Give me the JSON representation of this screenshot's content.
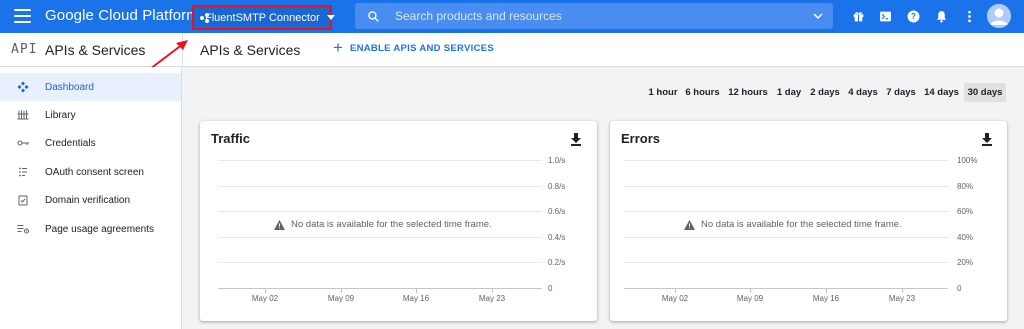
{
  "topbar": {
    "brand": "Google Cloud Platform",
    "project_name": "FluentSMTP Connector",
    "search_placeholder": "Search products and resources",
    "icons": [
      "gift-icon",
      "terminal-icon",
      "help-icon",
      "notifications-icon",
      "more-vert-icon"
    ]
  },
  "subheader": {
    "logo": "API",
    "section_title": "APIs & Services",
    "page_title": "APIs & Services",
    "enable_label": "ENABLE APIS AND SERVICES"
  },
  "sidebar": {
    "items": [
      {
        "label": "Dashboard",
        "icon": "dashboard-icon",
        "active": true
      },
      {
        "label": "Library",
        "icon": "library-icon",
        "active": false
      },
      {
        "label": "Credentials",
        "icon": "key-icon",
        "active": false
      },
      {
        "label": "OAuth consent screen",
        "icon": "consent-icon",
        "active": false
      },
      {
        "label": "Domain verification",
        "icon": "checkbox-icon",
        "active": false
      },
      {
        "label": "Page usage agreements",
        "icon": "settings-list-icon",
        "active": false
      }
    ]
  },
  "time_ranges": {
    "options": [
      "1 hour",
      "6 hours",
      "12 hours",
      "1 day",
      "2 days",
      "4 days",
      "7 days",
      "14 days",
      "30 days"
    ],
    "selected": "30 days"
  },
  "traffic_card": {
    "title": "Traffic",
    "no_data": "No data is available for the selected time frame.",
    "y_ticks": [
      "1.0/s",
      "0.8/s",
      "0.6/s",
      "0.4/s",
      "0.2/s",
      "0"
    ],
    "x_ticks": [
      "May 02",
      "May 09",
      "May 16",
      "May 23"
    ]
  },
  "errors_card": {
    "title": "Errors",
    "no_data": "No data is available for the selected time frame.",
    "y_ticks": [
      "100%",
      "80%",
      "60%",
      "40%",
      "20%",
      "0"
    ],
    "x_ticks": [
      "May 02",
      "May 09",
      "May 16",
      "May 23"
    ]
  },
  "colors": {
    "brand_blue": "#1a73e8",
    "highlight_red": "#e8131f",
    "active_nav_bg": "#e8f0fe"
  }
}
